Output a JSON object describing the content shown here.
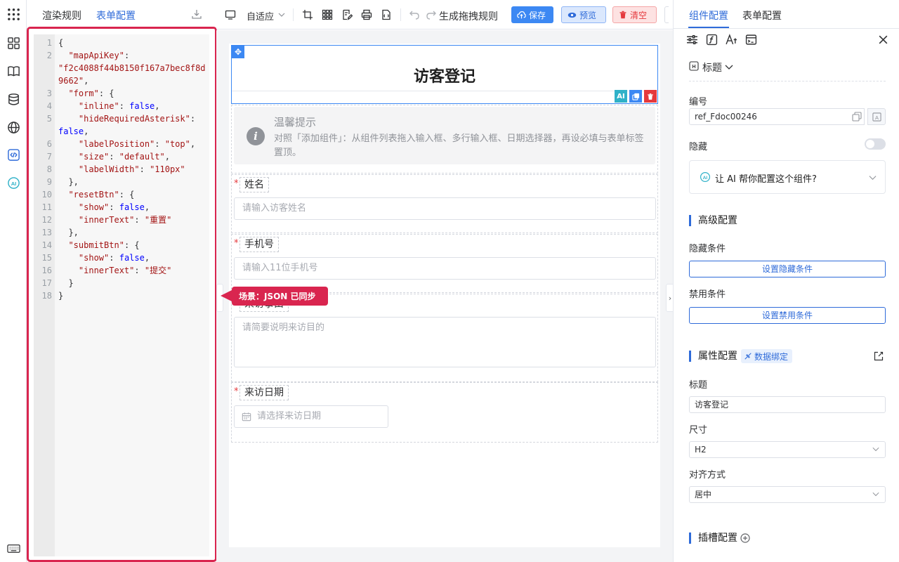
{
  "left_panel": {
    "tabs": [
      "渲染规则",
      "表单配置"
    ],
    "active_tab": "表单配置",
    "code_lines": [
      {
        "n": "1",
        "html": "{"
      },
      {
        "n": "2",
        "html": "  <span class='k'>\"mapApiKey\"</span>:"
      },
      {
        "n": "",
        "html": "<span class='s'>\"f2c4088f44b8150f167a7bec8f8d</span>"
      },
      {
        "n": "",
        "html": "<span class='s'>9662\"</span>,"
      },
      {
        "n": "3",
        "html": "  <span class='k'>\"form\"</span>: {"
      },
      {
        "n": "4",
        "html": "    <span class='k'>\"inline\"</span>: <span class='b'>false</span>,"
      },
      {
        "n": "5",
        "html": "    <span class='k'>\"hideRequiredAsterisk\"</span>:"
      },
      {
        "n": "",
        "html": "<span class='b'>false</span>,"
      },
      {
        "n": "6",
        "html": "    <span class='k'>\"labelPosition\"</span>: <span class='s'>\"top\"</span>,"
      },
      {
        "n": "7",
        "html": "    <span class='k'>\"size\"</span>: <span class='s'>\"default\"</span>,"
      },
      {
        "n": "8",
        "html": "    <span class='k'>\"labelWidth\"</span>: <span class='s'>\"110px\"</span>"
      },
      {
        "n": "9",
        "html": "  },"
      },
      {
        "n": "10",
        "html": "  <span class='k'>\"resetBtn\"</span>: {"
      },
      {
        "n": "11",
        "html": "    <span class='k'>\"show\"</span>: <span class='b'>false</span>,"
      },
      {
        "n": "12",
        "html": "    <span class='k'>\"innerText\"</span>: <span class='s'>\"重置\"</span>"
      },
      {
        "n": "13",
        "html": "  },"
      },
      {
        "n": "14",
        "html": "  <span class='k'>\"submitBtn\"</span>: {"
      },
      {
        "n": "15",
        "html": "    <span class='k'>\"show\"</span>: <span class='b'>false</span>,"
      },
      {
        "n": "16",
        "html": "    <span class='k'>\"innerText\"</span>: <span class='s'>\"提交\"</span>"
      },
      {
        "n": "17",
        "html": "  }"
      },
      {
        "n": "18",
        "html": "}"
      }
    ]
  },
  "toolbar": {
    "zoom_mode": "自适应",
    "generate_label": "生成拖拽规则",
    "save_label": "保存",
    "preview_label": "预览",
    "clear_label": "清空"
  },
  "canvas": {
    "form_title": "访客登记",
    "widget_actions": [
      "AI",
      "copy",
      "delete"
    ],
    "tip": {
      "title": "温馨提示",
      "desc": "对照「添加组件」：从组件列表拖入输入框、多行输入框、日期选择器，再设必填与表单标签置顶。"
    },
    "fields": [
      {
        "label": "姓名",
        "placeholder": "请输入访客姓名",
        "required": true
      },
      {
        "label": "手机号",
        "placeholder": "请输入11位手机号",
        "required": true
      },
      {
        "label": "来访事由",
        "placeholder": "请简要说明来访目的",
        "required": false
      },
      {
        "label": "来访日期",
        "placeholder": "请选择来访日期",
        "required": true
      }
    ],
    "toast": "场景：JSON 已同步"
  },
  "right_panel": {
    "tabs": [
      "组件配置",
      "表单配置"
    ],
    "active_tab": "组件配置",
    "component_type": "标题",
    "id_label": "编号",
    "id_value": "ref_Fdoc00246",
    "hidden_label": "隐藏",
    "hidden_on": false,
    "ai_prompt": "让 AI 帮你配置这个组件?",
    "advanced_title": "高级配置",
    "hide_cond_label": "隐藏条件",
    "hide_cond_button": "设置隐藏条件",
    "disable_cond_label": "禁用条件",
    "disable_cond_button": "设置禁用条件",
    "props_title": "属性配置",
    "data_binding": "数据绑定",
    "prop_title_label": "标题",
    "prop_title_value": "访客登记",
    "size_label": "尺寸",
    "size_value": "H2",
    "align_label": "对齐方式",
    "align_value": "居中",
    "slot_title": "插槽配置"
  },
  "colors": {
    "accent": "#2f6bd9",
    "highlight_frame": "#d9254f",
    "danger": "#e5393d"
  }
}
